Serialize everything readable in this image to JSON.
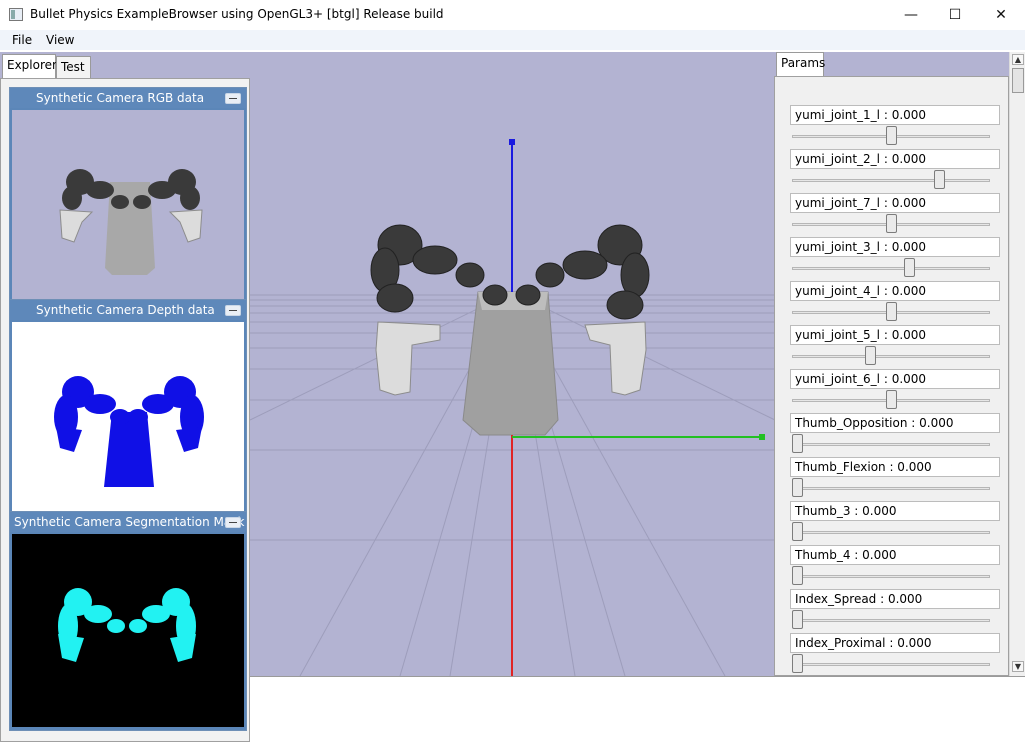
{
  "window": {
    "title": "Bullet Physics ExampleBrowser using OpenGL3+ [btgl] Release build",
    "minimize_label": "—",
    "maximize_label": "☐",
    "close_label": "✕"
  },
  "menu": {
    "items": [
      {
        "label": "File"
      },
      {
        "label": "View"
      }
    ]
  },
  "explorer": {
    "tabs": [
      {
        "label": "Explorer"
      },
      {
        "label": "Test"
      }
    ],
    "cameras": [
      {
        "title": "Synthetic Camera RGB data"
      },
      {
        "title": "Synthetic Camera Depth data"
      },
      {
        "title": "Synthetic Camera Segmentation Mask"
      }
    ]
  },
  "params": {
    "tab": "Params",
    "items": [
      {
        "label": "yumi_joint_1_l : 0.000",
        "slider": 0.5
      },
      {
        "label": "yumi_joint_2_l : 0.000",
        "slider": 0.76
      },
      {
        "label": "yumi_joint_7_l : 0.000",
        "slider": 0.5
      },
      {
        "label": "yumi_joint_3_l : 0.000",
        "slider": 0.6
      },
      {
        "label": "yumi_joint_4_l : 0.000",
        "slider": 0.5
      },
      {
        "label": "yumi_joint_5_l : 0.000",
        "slider": 0.39
      },
      {
        "label": "yumi_joint_6_l : 0.000",
        "slider": 0.5
      },
      {
        "label": "Thumb_Opposition : 0.000",
        "slider": 0.0
      },
      {
        "label": "Thumb_Flexion : 0.000",
        "slider": 0.0
      },
      {
        "label": "Thumb_3 : 0.000",
        "slider": 0.0
      },
      {
        "label": "Thumb_4 : 0.000",
        "slider": 0.0
      },
      {
        "label": "Index_Spread : 0.000",
        "slider": 0.0
      },
      {
        "label": "Index_Proximal : 0.000",
        "slider": 0.0
      }
    ]
  },
  "colors": {
    "viewport_bg": "#b3b3d2",
    "axis_x": "#e02424",
    "axis_y": "#22c022",
    "axis_z": "#1a1ae0",
    "depth_fill": "#1010e6",
    "segmentation_fill": "#22f2f2"
  }
}
